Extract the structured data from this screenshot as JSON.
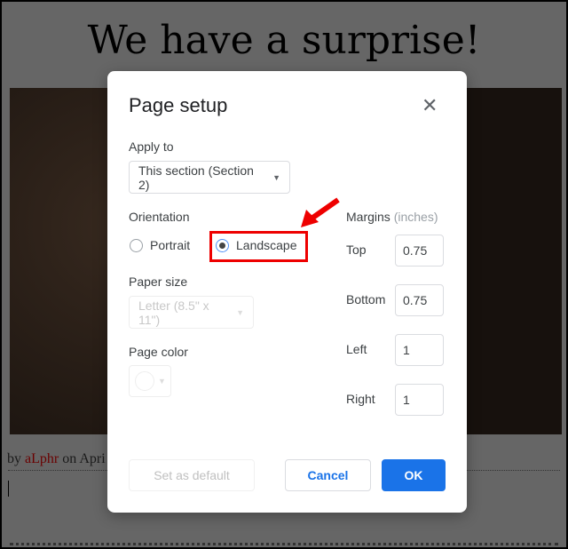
{
  "document": {
    "title": "We have a surprise!",
    "byline_prefix": "by ",
    "author": "aLphr",
    "byline_suffix": " on Apri"
  },
  "dialog": {
    "title": "Page setup",
    "close_icon": "close-icon",
    "apply_to": {
      "label": "Apply to",
      "value": "This section (Section 2)"
    },
    "orientation": {
      "label": "Orientation",
      "options": [
        "Portrait",
        "Landscape"
      ],
      "selected": "Landscape"
    },
    "paper_size": {
      "label": "Paper size",
      "value": "Letter (8.5\" x 11\")"
    },
    "page_color": {
      "label": "Page color",
      "value": "#ffffff"
    },
    "margins": {
      "label": "Margins",
      "unit": "(inches)",
      "top_label": "Top",
      "top": "0.75",
      "bottom_label": "Bottom",
      "bottom": "0.75",
      "left_label": "Left",
      "left": "1",
      "right_label": "Right",
      "right": "1"
    },
    "buttons": {
      "set_default": "Set as default",
      "cancel": "Cancel",
      "ok": "OK"
    }
  },
  "colors": {
    "accent": "#1a73e8",
    "highlight": "#ee0000"
  }
}
